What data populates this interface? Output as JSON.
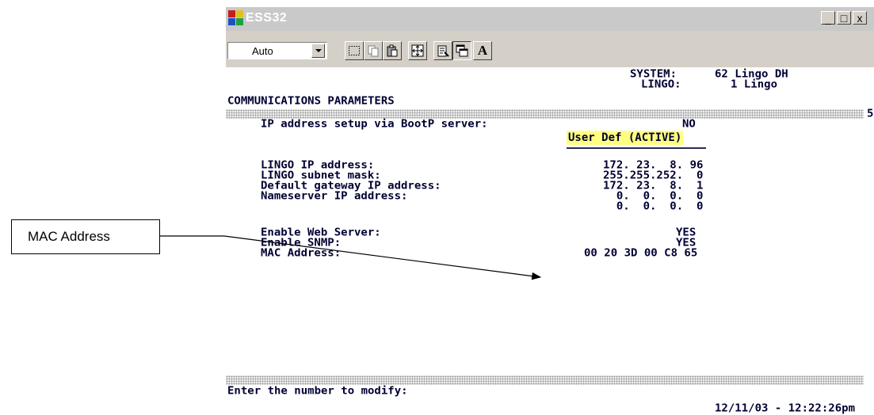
{
  "callout": {
    "label": "MAC Address"
  },
  "window": {
    "title": "ESS32",
    "controls": {
      "minimize": "_",
      "maximize": "□",
      "close": "x"
    }
  },
  "toolbar": {
    "font_select_value": "Auto",
    "buttons": [
      {
        "name": "select-icon"
      },
      {
        "name": "copy-icon"
      },
      {
        "name": "paste-icon"
      },
      {
        "name": "fullscreen-icon"
      },
      {
        "name": "properties-icon"
      },
      {
        "name": "background-icon"
      },
      {
        "name": "font-icon",
        "label": "A"
      }
    ]
  },
  "screen": {
    "system_label": "SYSTEM:",
    "system_value": "62 Lingo DH",
    "lingo_label": "LINGO:",
    "lingo_value": "1 Lingo",
    "section_title": "COMMUNICATIONS PARAMETERS",
    "page_number": "5",
    "bootp_label": "IP address setup via BootP server:",
    "bootp_value": "NO",
    "mode_badge": "User Def (ACTIVE)",
    "rows": [
      {
        "label": "LINGO IP address:",
        "value": "172. 23.  8. 96"
      },
      {
        "label": "LINGO subnet mask:",
        "value": "255.255.252.  0"
      },
      {
        "label": "Default gateway IP address:",
        "value": "172. 23.  8.  1"
      },
      {
        "label": "Nameserver IP address:",
        "value": "  0.  0.  0.  0"
      },
      {
        "label": "",
        "value": "  0.  0.  0.  0"
      }
    ],
    "web_server_label": "Enable Web Server:",
    "web_server_value": "YES",
    "snmp_label": "Enable SNMP:",
    "snmp_value": "YES",
    "mac_label": "MAC Address:",
    "mac_value": "00 20 3D 00 C8 65",
    "prompt": "Enter the number to modify:",
    "datetime": "12/11/03 - 12:22:26pm"
  }
}
